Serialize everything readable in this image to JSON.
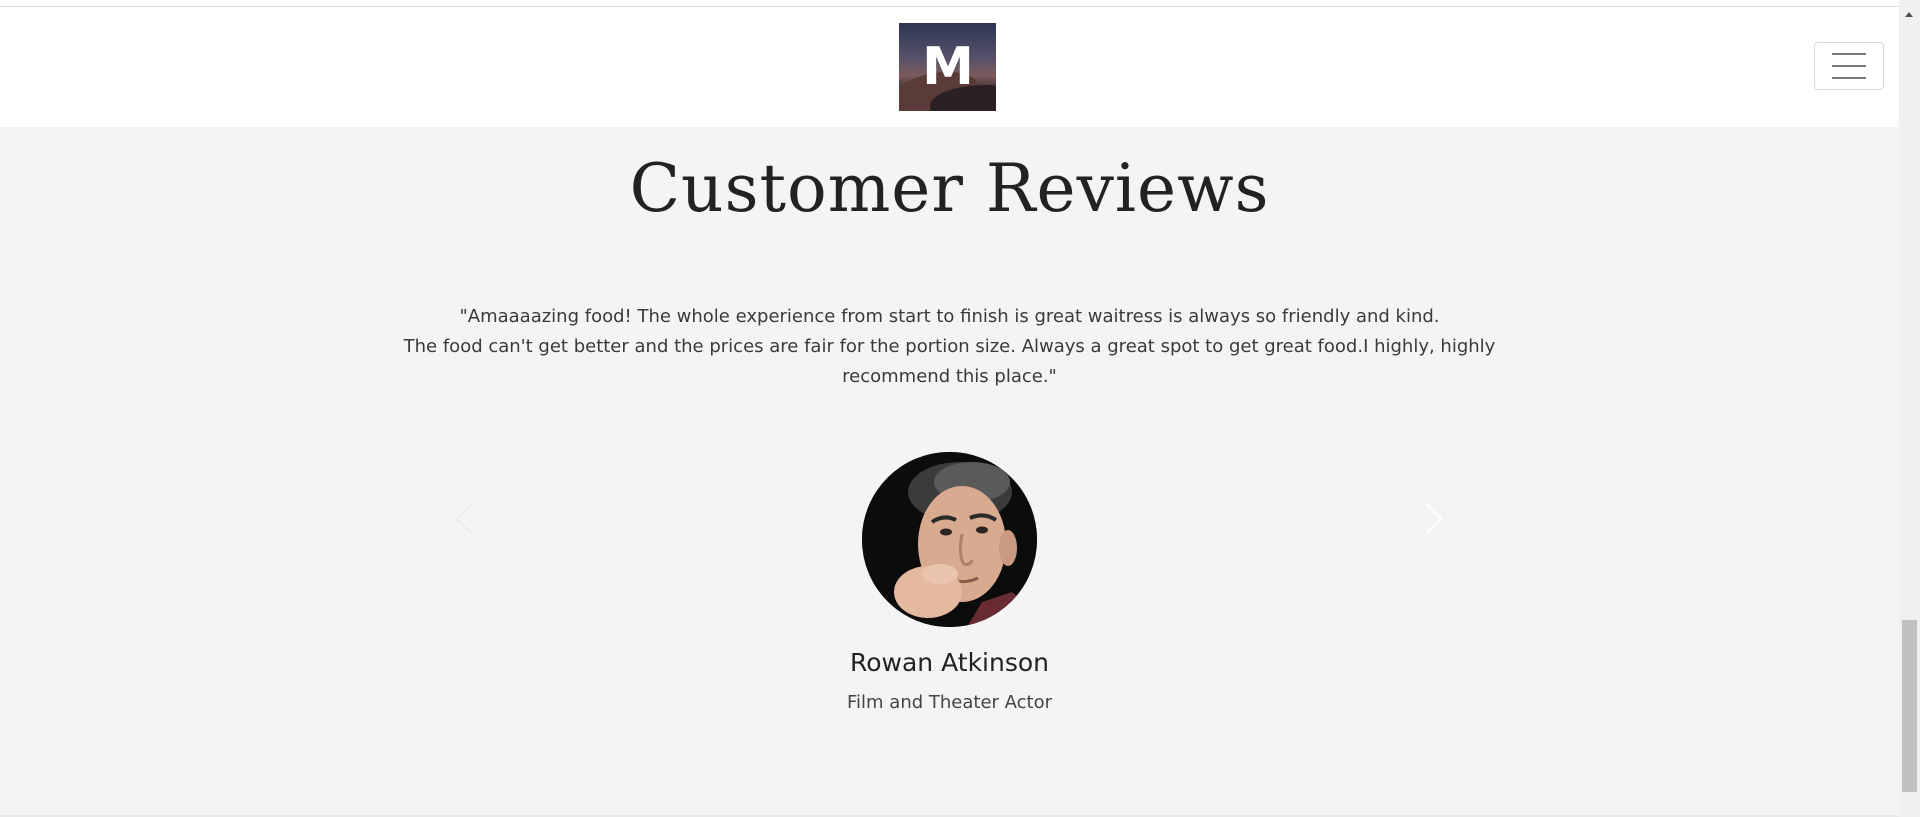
{
  "header": {
    "logo_letter": "M",
    "menu_toggle_icon": "hamburger-icon"
  },
  "section": {
    "title": "Customer Reviews"
  },
  "review": {
    "quote_lines": [
      "\"Amaaaazing food! The whole experience from start to finish is great waitress is always so friendly and kind.",
      "The food can't get better and the prices are fair for the portion size. Always a great spot to get great food.I highly, highly recommend this place.\""
    ],
    "reviewer_name": "Rowan Atkinson",
    "reviewer_role": "Film and Theater Actor"
  },
  "carousel": {
    "prev_icon": "chevron-left-icon",
    "next_icon": "chevron-right-icon"
  },
  "colors": {
    "page_background": "#f4f4f4",
    "navbar_background": "#ffffff",
    "text_dark": "#222222"
  }
}
